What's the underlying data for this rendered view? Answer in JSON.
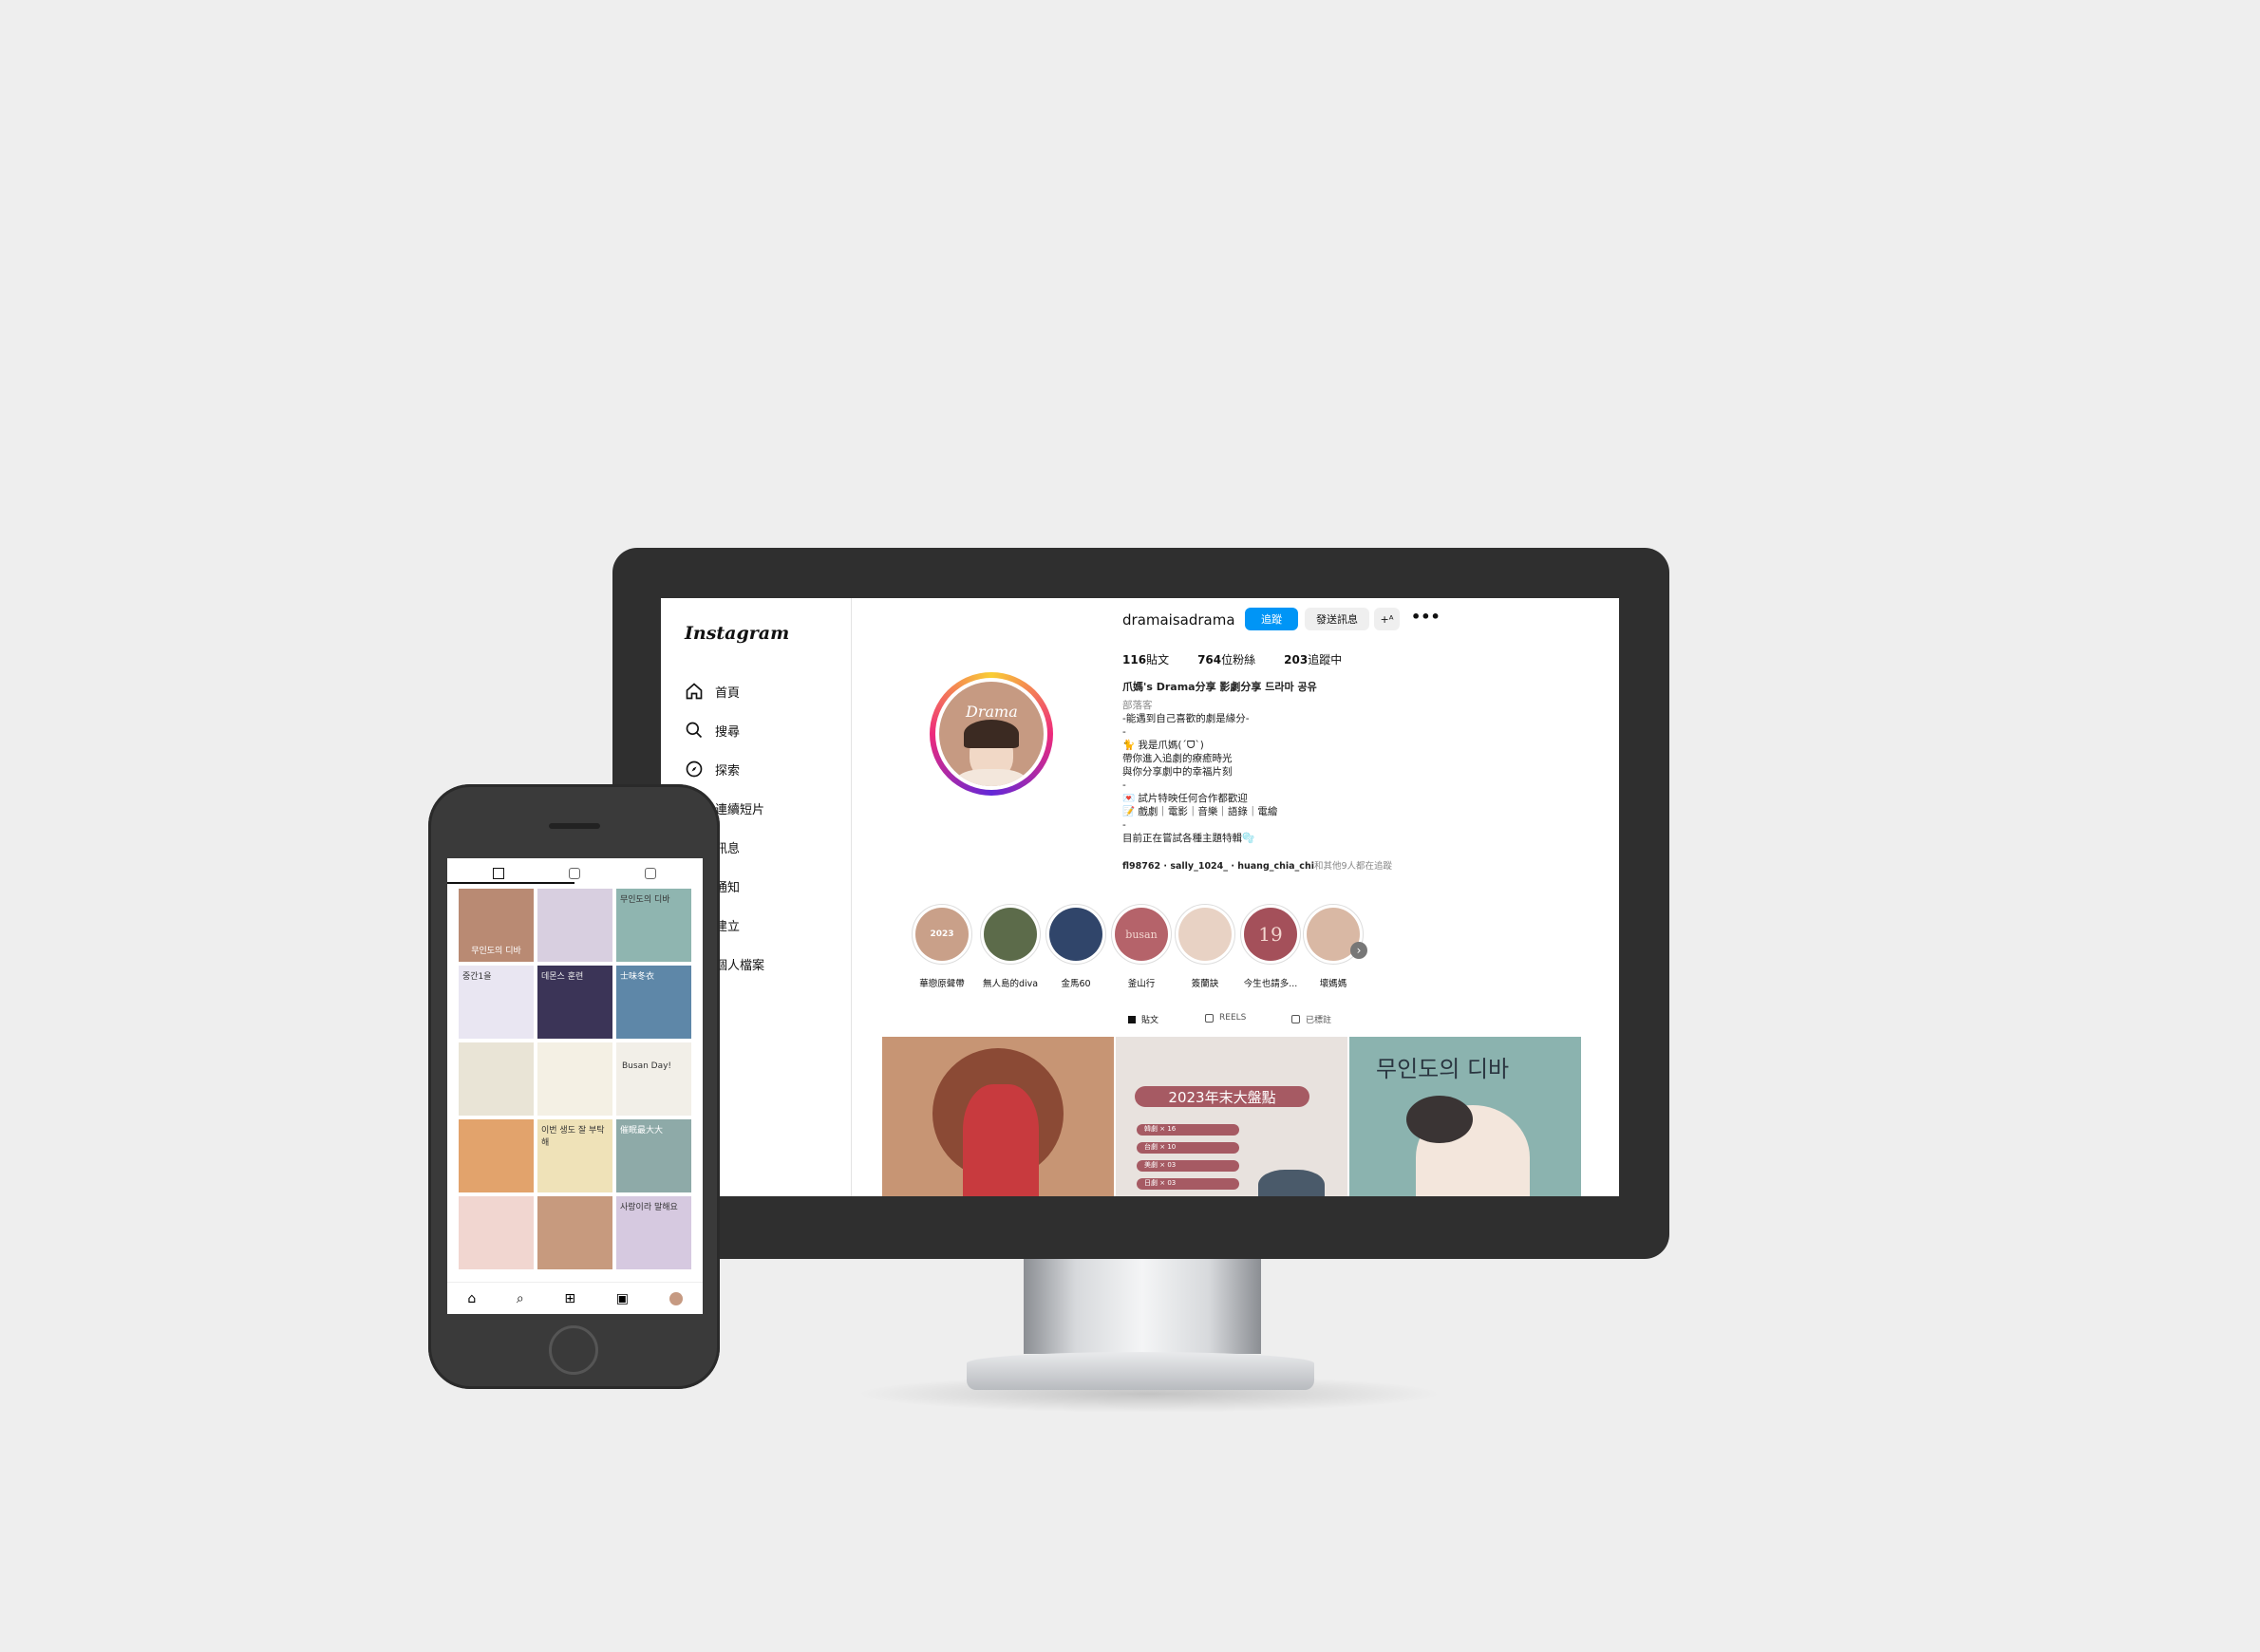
{
  "app": "Instagram",
  "sidebar": {
    "items": [
      {
        "label": "首頁",
        "icon": "home-icon"
      },
      {
        "label": "搜尋",
        "icon": "search-icon"
      },
      {
        "label": "探索",
        "icon": "compass-icon"
      },
      {
        "label": "連續短片",
        "icon": "reels-icon"
      },
      {
        "label": "訊息",
        "icon": "message-icon"
      },
      {
        "label": "通知",
        "icon": "heart-icon"
      },
      {
        "label": "建立",
        "icon": "plus-icon"
      },
      {
        "label": "個人檔案",
        "icon": "profile-icon"
      }
    ]
  },
  "profile": {
    "username": "dramaisadrama",
    "follow_label": "追蹤",
    "message_label": "發送訊息",
    "add_label": "+ᴬ",
    "more_label": "•••",
    "posts_count": "116",
    "posts_label": "貼文",
    "followers_count": "764",
    "followers_label": "位粉絲",
    "following_count": "203",
    "following_label": "追蹤中",
    "display_name": "爪媽's Drama分享 影劇分享 드라마 공유",
    "category": "部落客",
    "bio_line1": "-能遇到自己喜歡的劇是緣分-",
    "bio_line2": "-",
    "bio_line3": "🐈 我是爪媽(ˊᗜˋ)",
    "bio_line4": "帶你進入追劇的療癒時光",
    "bio_line5": "與你分享劇中的幸福片刻",
    "bio_line6": "-",
    "bio_line7": "💌 試片特映任何合作都歡迎",
    "bio_line8": "📝 戲劇｜電影｜音樂｜語錄｜電繪",
    "bio_line9": "-",
    "bio_line10": "目前正在嘗試各種主題特輯🫧",
    "followed_by_users": "fl98762 · sally_1024_ · huang_chia_chi",
    "followed_by_suffix": "和其他9人都在追蹤"
  },
  "avatar_text": "Drama",
  "stories": [
    {
      "label": "華戀原聲帶",
      "color": "#c9a089",
      "text": "2023"
    },
    {
      "label": "無人島的diva",
      "color": "#5c6b4a",
      "text": ""
    },
    {
      "label": "金馬60",
      "color": "#30456a",
      "text": ""
    },
    {
      "label": "釜山行",
      "color": "#b5636a",
      "text": "busan"
    },
    {
      "label": "簽蘭訣",
      "color": "#e8d2c4",
      "text": ""
    },
    {
      "label": "今生也請多...",
      "color": "#a4505a",
      "text": "19"
    },
    {
      "label": "壞媽媽",
      "color": "#d9b8a4",
      "text": ""
    }
  ],
  "tabs": {
    "posts": "貼文",
    "reels": "REELS",
    "tagged": "已標註"
  },
  "posts": {
    "post2_title": "2023年末大盤點",
    "post2_rows": [
      "韓劇 × 16",
      "台劇 × 10",
      "美劇 × 03",
      "日劇 × 03"
    ],
    "post3_title": "무인도의 디바"
  },
  "phone": {
    "grid_colors": [
      "#b98a73",
      "#d8cfe0",
      "#8fb5b0",
      "#e9e6f2",
      "#3b3457",
      "#5e87a8",
      "#e9e4d6",
      "#f4f0e4",
      "#f2efe8",
      "#e2a36c",
      "#efe2b8",
      "#8eaaa8",
      "#f1d6d0",
      "#c79a7e",
      "#d6c9e0"
    ],
    "grid_texts": [
      "무인도의 디바",
      "",
      "무인도의 디바",
      "중간1을",
      "데몬스 훈련",
      "士味冬衣",
      "",
      "",
      "Busan Day!",
      "",
      "이번 생도 잘 부탁해",
      "催眠最大大",
      "",
      "",
      "사랑이라 말해요"
    ]
  }
}
